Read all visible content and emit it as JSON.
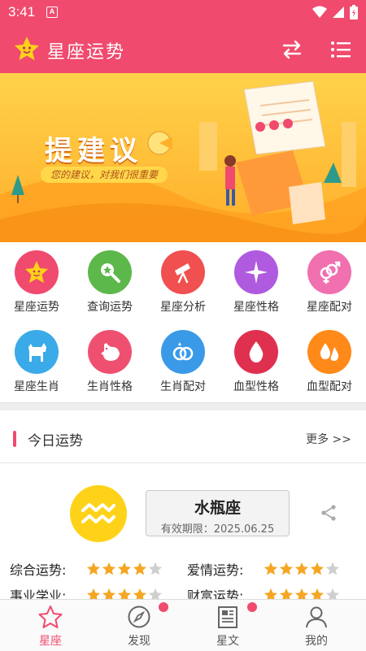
{
  "status": {
    "time": "3:41",
    "a_badge": "A"
  },
  "app": {
    "title": "星座运势"
  },
  "banner": {
    "title": "提建议",
    "subtitle": "您的建议，对我们很重要"
  },
  "grid": {
    "items": [
      {
        "label": "星座运势",
        "icon": "star-face-icon",
        "color": "#f04a6e"
      },
      {
        "label": "查询运势",
        "icon": "magnifier-icon",
        "color": "#5cb84a"
      },
      {
        "label": "星座分析",
        "icon": "telescope-icon",
        "color": "#f05050"
      },
      {
        "label": "星座性格",
        "icon": "sparkle-icon",
        "color": "#b05ae0"
      },
      {
        "label": "星座配对",
        "icon": "gender-pair-icon",
        "color": "#f070b0"
      },
      {
        "label": "星座生肖",
        "icon": "dog-icon",
        "color": "#3aaae8"
      },
      {
        "label": "生肖性格",
        "icon": "rooster-icon",
        "color": "#f05070"
      },
      {
        "label": "生肖配对",
        "icon": "rings-icon",
        "color": "#3a9ae8"
      },
      {
        "label": "血型性格",
        "icon": "blood-drop-icon",
        "color": "#e03050"
      },
      {
        "label": "血型配对",
        "icon": "blood-drops-icon",
        "color": "#ff8a1a"
      }
    ]
  },
  "today": {
    "title": "今日运势",
    "more": "更多 >>",
    "sign": {
      "name": "水瓶座",
      "valid": "有效期限：2025.06.25",
      "icon": "aquarius-icon",
      "color": "#ffd21a"
    },
    "fortunes": [
      {
        "label": "综合运势:",
        "stars": 4,
        "max": 5
      },
      {
        "label": "爱情运势:",
        "stars": 4,
        "max": 5
      },
      {
        "label": "事业学业:",
        "stars": 4,
        "max": 5
      },
      {
        "label": "财富运势:",
        "stars": 4,
        "max": 5
      }
    ]
  },
  "nav": {
    "items": [
      {
        "label": "星座",
        "icon": "star-outline-icon",
        "active": true
      },
      {
        "label": "发现",
        "icon": "compass-icon",
        "badge": true
      },
      {
        "label": "星文",
        "icon": "article-icon",
        "badge": true
      },
      {
        "label": "我的",
        "icon": "person-icon"
      }
    ]
  },
  "colors": {
    "brand": "#f04a6e",
    "star": "#f5a623",
    "star_empty": "#cfcfcf"
  }
}
